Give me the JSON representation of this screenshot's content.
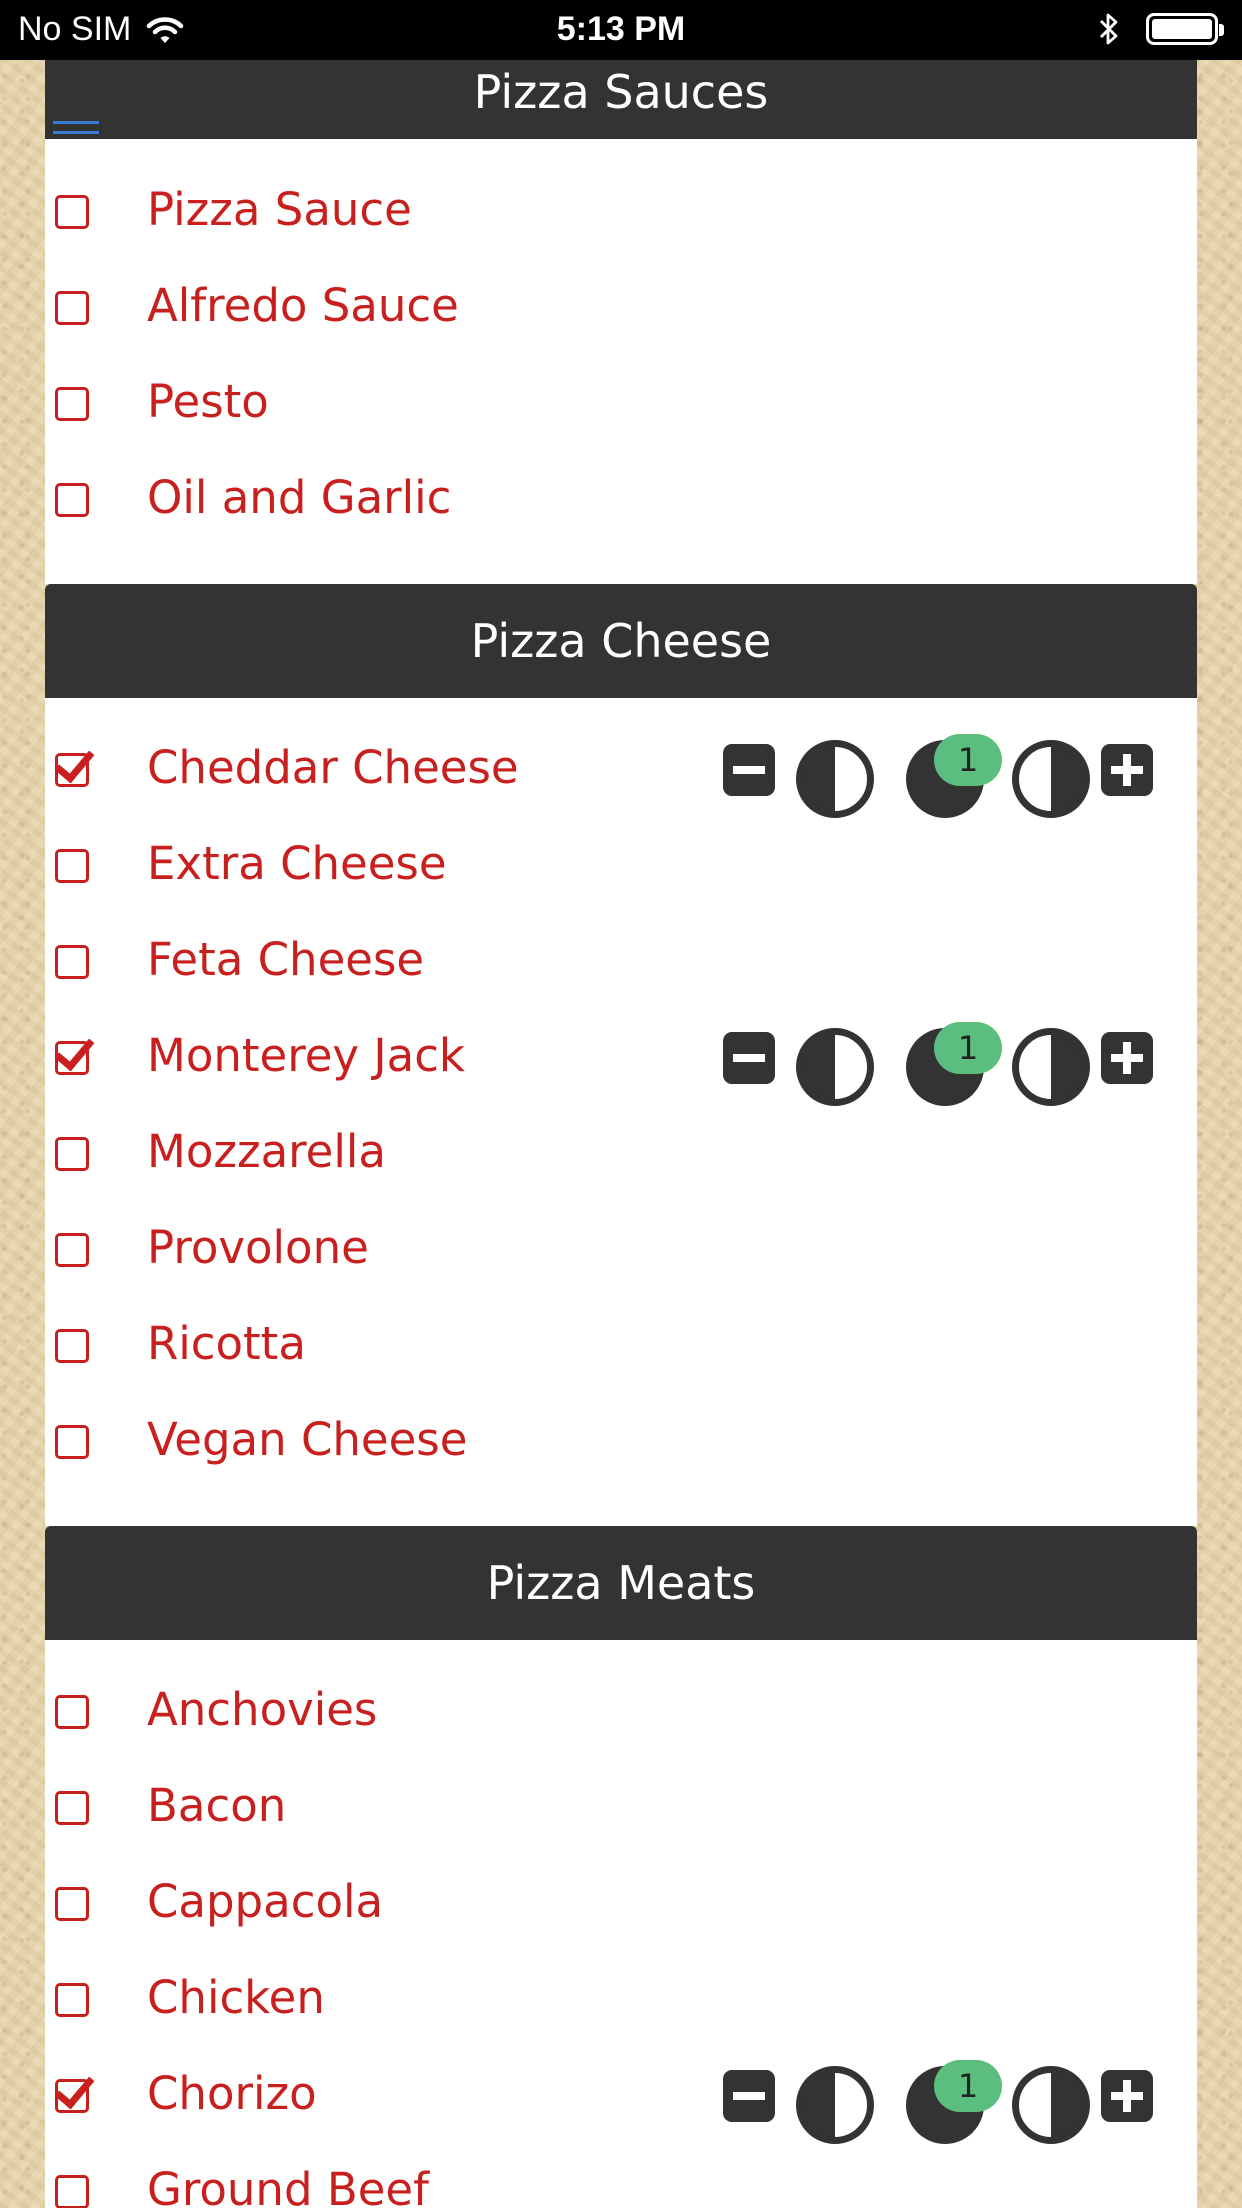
{
  "status_bar": {
    "carrier": "No SIM",
    "time": "5:13 PM"
  },
  "sections": [
    {
      "title": "Pizza Sauces"
    },
    {
      "title": "Pizza Cheese"
    },
    {
      "title": "Pizza Meats"
    }
  ],
  "sauces": [
    {
      "label": "Pizza Sauce",
      "checked": false
    },
    {
      "label": "Alfredo Sauce",
      "checked": false
    },
    {
      "label": "Pesto",
      "checked": false
    },
    {
      "label": "Oil and Garlic",
      "checked": false
    }
  ],
  "cheese": [
    {
      "label": "Cheddar Cheese",
      "checked": true,
      "count": "1"
    },
    {
      "label": "Extra Cheese",
      "checked": false
    },
    {
      "label": "Feta Cheese",
      "checked": false
    },
    {
      "label": "Monterey Jack",
      "checked": true,
      "count": "1"
    },
    {
      "label": "Mozzarella",
      "checked": false
    },
    {
      "label": "Provolone",
      "checked": false
    },
    {
      "label": "Ricotta",
      "checked": false
    },
    {
      "label": "Vegan Cheese",
      "checked": false
    }
  ],
  "meats": [
    {
      "label": "Anchovies",
      "checked": false
    },
    {
      "label": "Bacon",
      "checked": false
    },
    {
      "label": "Cappacola",
      "checked": false
    },
    {
      "label": "Chicken",
      "checked": false
    },
    {
      "label": "Chorizo",
      "checked": true,
      "count": "1"
    },
    {
      "label": "Ground Beef",
      "checked": false
    }
  ],
  "colors": {
    "accent": "#c8201e",
    "header": "#333333",
    "badge": "#5bbd7e",
    "menu_icon": "#3a7bd5"
  },
  "icons": {
    "menu": "hamburger-menu-icon",
    "decrease": "minus-square-icon",
    "left_half": "left-half-icon",
    "whole": "whole-icon",
    "right_half": "right-half-icon",
    "increase": "plus-square-icon"
  }
}
